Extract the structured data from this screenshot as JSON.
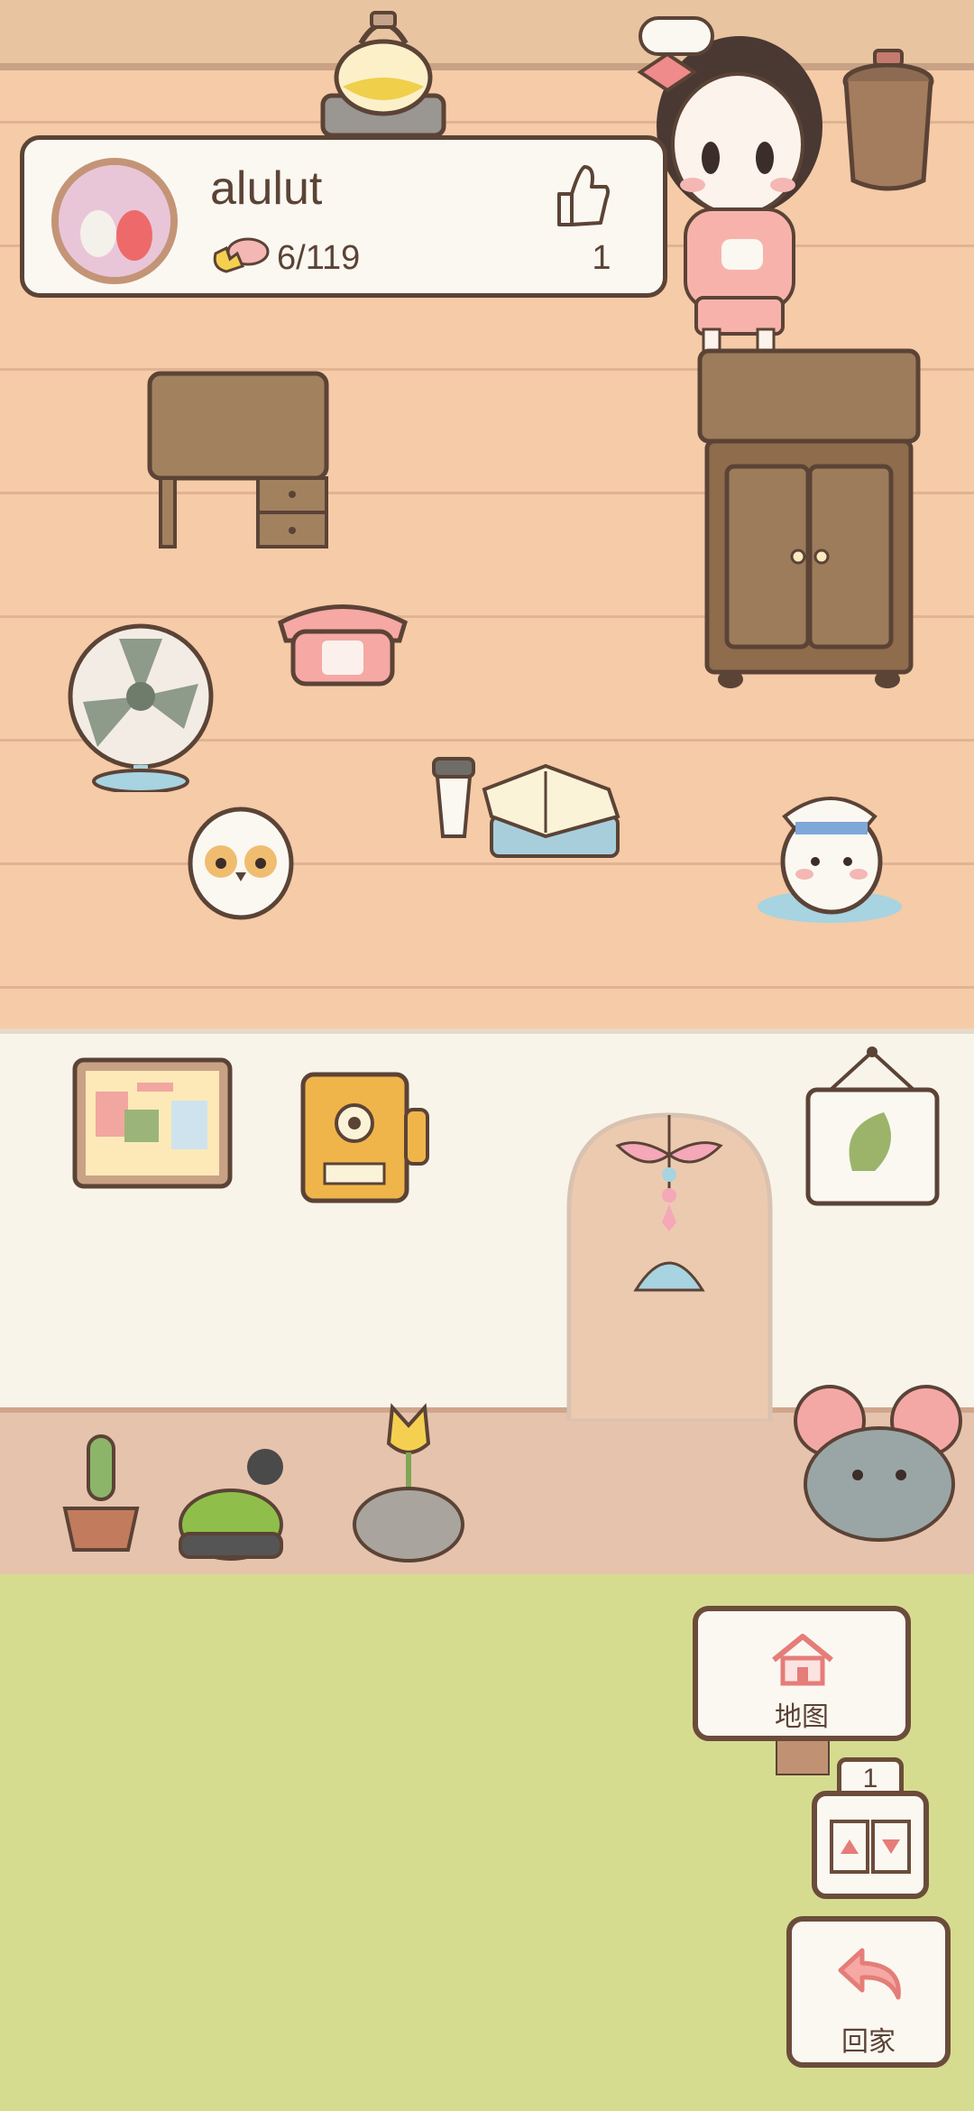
{
  "profile": {
    "username": "alulut",
    "fish_count": "6/119",
    "likes": "1"
  },
  "navigation": {
    "map_label": "地图",
    "home_label": "回家",
    "floor_number": "1"
  }
}
